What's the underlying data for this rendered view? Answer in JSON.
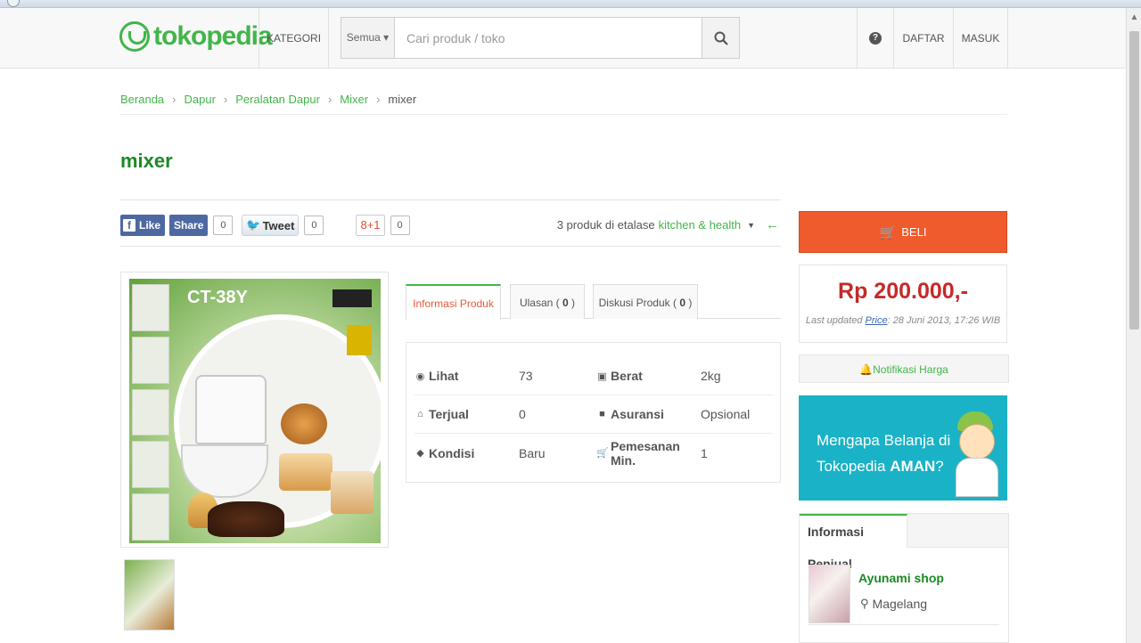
{
  "header": {
    "logo_text": "tokopedia",
    "kategori": "KATEGORI",
    "search_category": "Semua ▾",
    "search_placeholder": "Cari produk / toko",
    "help": "?",
    "daftar": "DAFTAR",
    "masuk": "MASUK"
  },
  "breadcrumb": [
    "Beranda",
    "Dapur",
    "Peralatan Dapur",
    "Mixer",
    "mixer"
  ],
  "product": {
    "title": "mixer",
    "image_model": "CT-38Y"
  },
  "social": {
    "fb_like": "Like",
    "fb_like_count": "0",
    "fb_share": "Share",
    "tweet": "Tweet",
    "tweet_count": "0",
    "gplus": "8+1",
    "gplus_count": "0"
  },
  "etalase": {
    "prefix": "3 produk di etalase",
    "name": "kitchen & health"
  },
  "tabs": [
    {
      "label": "Informasi Produk"
    },
    {
      "label": "Ulasan (",
      "count": "0",
      "suffix": ")"
    },
    {
      "label": "Diskusi Produk (",
      "count": "0",
      "suffix": ")"
    }
  ],
  "info": {
    "rows": [
      {
        "label": "Lihat",
        "value": "73",
        "label2": "Berat",
        "value2": "2kg"
      },
      {
        "label": "Terjual",
        "value": "0",
        "label2": "Asuransi",
        "value2": "Opsional"
      },
      {
        "label": "Kondisi",
        "value": "Baru",
        "label2": "Pemesanan Min.",
        "value2": "1"
      }
    ]
  },
  "buy": {
    "button": "BELI",
    "price": "Rp 200.000,-",
    "last_updated_prefix": "Last updated",
    "last_updated_link": "Price",
    "last_updated_date": ": 28 Juni 2013, 17:26 WIB",
    "notif": "Notifikasi Harga"
  },
  "banner": {
    "line1": "Mengapa Belanja di",
    "line2_prefix": "Tokopedia",
    "line2_bold": "AMAN",
    "line2_suffix": "?"
  },
  "seller": {
    "tab": "Informasi Penjual",
    "name": "Ayunami shop",
    "location": "Magelang"
  },
  "colors": {
    "brand_green": "#42b549",
    "buy_orange": "#ef5b2c",
    "price_red": "#c42a2a",
    "banner_teal": "#1ab2c6"
  }
}
